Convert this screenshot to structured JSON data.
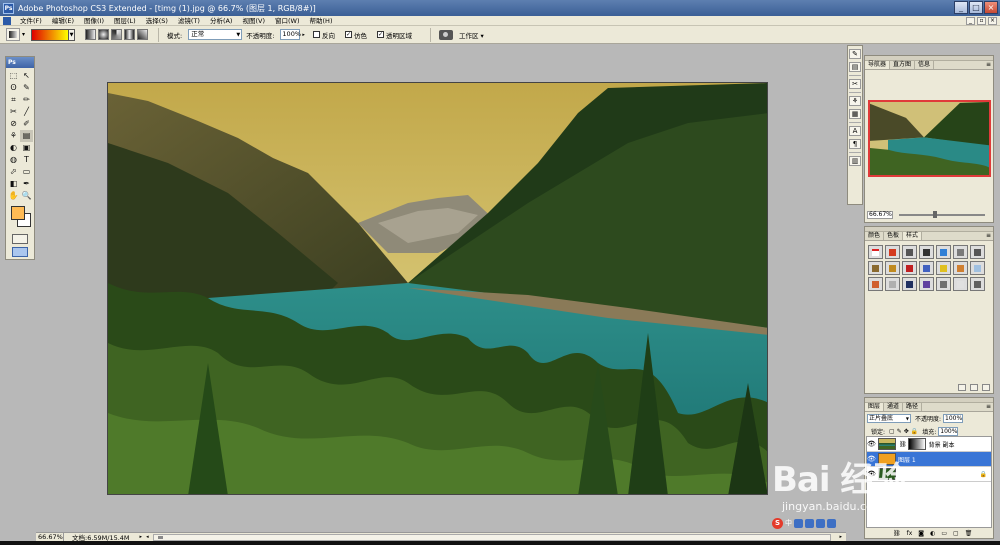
{
  "window": {
    "title": "Adobe Photoshop CS3 Extended - [timg (1).jpg @ 66.7% (图层 1, RGB/8#)]",
    "app_icon": "Ps",
    "min": "_",
    "max": "□",
    "close": "×"
  },
  "menu": [
    "文件(F)",
    "编辑(E)",
    "图像(I)",
    "图层(L)",
    "选择(S)",
    "滤镜(T)",
    "分析(A)",
    "视图(V)",
    "窗口(W)",
    "帮助(H)"
  ],
  "options": {
    "mode_label": "模式:",
    "mode_value": "正常",
    "opacity_label": "不透明度:",
    "opacity_value": "100%",
    "reverse_label": "反向",
    "dither_label": "仿色",
    "transparency_label": "透明区域",
    "workspace_label": "工作区 ▾"
  },
  "toolbox": {
    "header": "Ps",
    "tools": [
      "⬚",
      "↖",
      "ʘ",
      "✎",
      "⌗",
      "✏",
      "✂",
      "╱",
      "⊘",
      "✐",
      "⚘",
      "▤",
      "◐",
      "▣",
      "◍",
      "◧",
      "✧",
      "T",
      "⬀",
      "✥",
      "▭",
      "✒",
      "✋",
      "🔍"
    ],
    "foreground_color": "#ffbb55",
    "background_color": "#ffffff"
  },
  "status": {
    "zoom": "66.67%",
    "doc": "文档:6.59M/15.4M"
  },
  "navigator": {
    "tabs": [
      "导航器",
      "直方图",
      "信息"
    ],
    "zoom": "66.67%"
  },
  "styles": {
    "tabs": [
      "颜色",
      "色板",
      "样式"
    ],
    "swatches": [
      "#ffffff",
      "#d43a1f",
      "#555555",
      "#333333",
      "#2f7fd6",
      "#7a7a7a",
      "#555555",
      "#8a6a30",
      "#c08a20",
      "#c02020",
      "#4060c0",
      "#e0c020",
      "#d08030",
      "#a0c0e0",
      "#d06030",
      "#b0b0b0",
      "#203060",
      "#6040a0",
      "#707070",
      "#e0e0e0",
      "#606060"
    ]
  },
  "layers": {
    "tabs": [
      "图层",
      "通道",
      "路径"
    ],
    "blend_mode": "正片叠底",
    "opacity_label": "不透明度:",
    "opacity_value": "100%",
    "lock_label": "锁定:",
    "fill_label": "填充:",
    "fill_value": "100%",
    "items": [
      {
        "name": "背景 副本",
        "selected": false
      },
      {
        "name": "图层 1",
        "selected": true
      },
      {
        "name": "",
        "selected": false
      }
    ]
  },
  "watermark": {
    "logo": "Bai 经验",
    "url": "jingyan.baidu.com"
  },
  "ime": {
    "logo": "S",
    "text": "中"
  }
}
